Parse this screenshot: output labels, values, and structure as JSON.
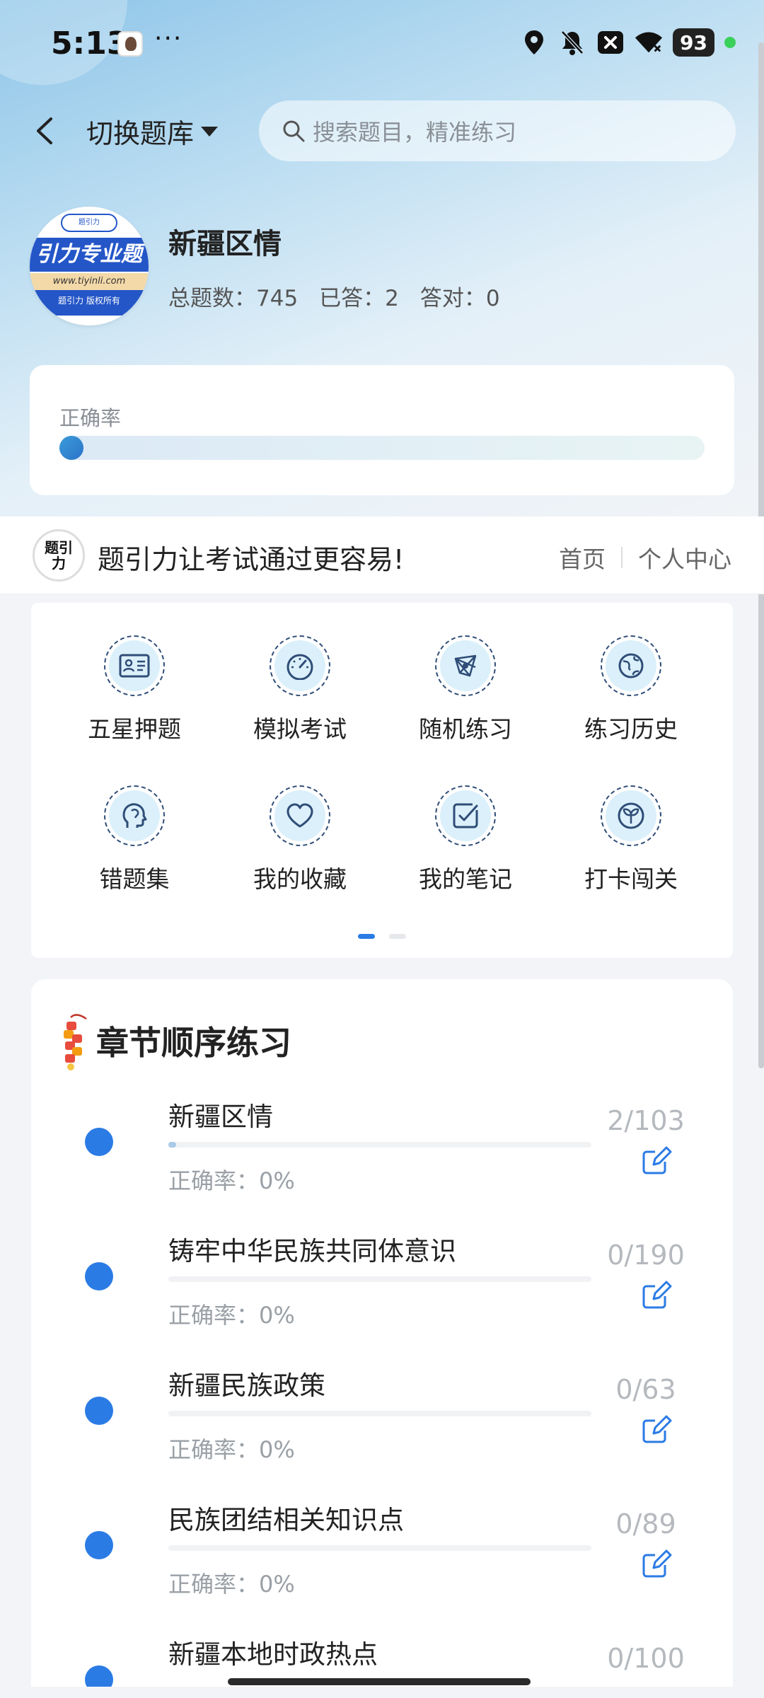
{
  "status_bar": {
    "time": "5:13",
    "more": "···",
    "battery": "93"
  },
  "nav": {
    "switch_label": "切换题库",
    "search_placeholder": "搜索题目，精准练习"
  },
  "bank": {
    "logo_band": "引力专业题",
    "logo_url": "www.tiyinli.com",
    "logo_copy": "题引力 版权所有",
    "logo_top": "题引力",
    "title": "新疆区情",
    "stats": {
      "total": "总题数：745",
      "answered": "已答：2",
      "correct": "答对：0"
    }
  },
  "accuracy": {
    "label": "正确率",
    "value_fraction": 0.0
  },
  "brand": {
    "logo_text": "题引力",
    "slogan": "题引力让考试通过更容易!",
    "home": "首页",
    "personal": "个人中心"
  },
  "functions": [
    {
      "label": "五星押题",
      "icon": "id-card-icon"
    },
    {
      "label": "模拟考试",
      "icon": "speedometer-icon"
    },
    {
      "label": "随机练习",
      "icon": "network-icon"
    },
    {
      "label": "练习历史",
      "icon": "globe-icon"
    },
    {
      "label": "错题集",
      "icon": "head-brain-icon"
    },
    {
      "label": "我的收藏",
      "icon": "heart-icon"
    },
    {
      "label": "我的笔记",
      "icon": "note-check-icon"
    },
    {
      "label": "打卡闯关",
      "icon": "sprout-icon"
    }
  ],
  "chapters": {
    "title": "章节顺序练习",
    "items": [
      {
        "name": "新疆区情",
        "accuracy": "正确率：0%",
        "count": "2/103",
        "progress": 0.019
      },
      {
        "name": "铸牢中华民族共同体意识",
        "accuracy": "正确率：0%",
        "count": "0/190",
        "progress": 0
      },
      {
        "name": "新疆民族政策",
        "accuracy": "正确率：0%",
        "count": "0/63",
        "progress": 0
      },
      {
        "name": "民族团结相关知识点",
        "accuracy": "正确率：0%",
        "count": "0/89",
        "progress": 0
      },
      {
        "name": "新疆本地时政热点",
        "accuracy": "",
        "count": "0/100",
        "progress": 0
      }
    ]
  },
  "colors": {
    "accent": "#2b7be5",
    "icon_fill": "#dbf0fa",
    "icon_stroke": "#2f4d77"
  }
}
